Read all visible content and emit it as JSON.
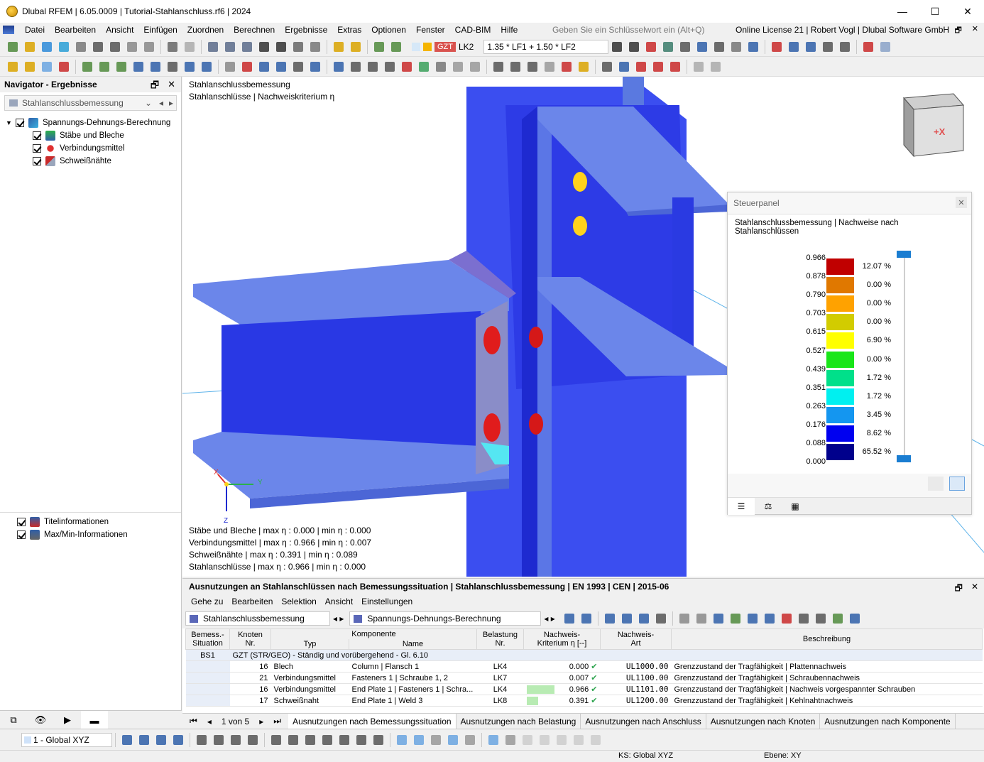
{
  "window": {
    "title": "Dlubal RFEM | 6.05.0009 | Tutorial-Stahlanschluss.rf6 | 2024",
    "controls": [
      "—",
      "☐",
      "✕"
    ]
  },
  "menubar": {
    "items": [
      "Datei",
      "Bearbeiten",
      "Ansicht",
      "Einfügen",
      "Zuordnen",
      "Berechnen",
      "Ergebnisse",
      "Extras",
      "Optionen",
      "Fenster",
      "CAD-BIM",
      "Hilfe"
    ],
    "search_placeholder": "Geben Sie ein Schlüsselwort ein (Alt+Q)",
    "license": "Online License 21 | Robert Vogl | Dlubal Software GmbH"
  },
  "loadcase": {
    "badge": "GZT",
    "case": "LK2",
    "combination": "1.35 * LF1 + 1.50 * LF2"
  },
  "navigator": {
    "title": "Navigator - Ergebnisse",
    "combo": "Stahlanschlussbemessung",
    "tree": [
      {
        "label": "Spannungs-Dehnungs-Berechnung",
        "icon": "stress-strain-icon"
      },
      {
        "label": "Stäbe und Bleche",
        "icon": "members-plates-icon"
      },
      {
        "label": "Verbindungsmittel",
        "icon": "fasteners-icon"
      },
      {
        "label": "Schweißnähte",
        "icon": "welds-icon"
      }
    ],
    "extra": [
      {
        "label": "Titelinformationen",
        "icon": "title-info-icon"
      },
      {
        "label": "Max/Min-Informationen",
        "icon": "maxmin-info-icon"
      }
    ]
  },
  "viewport": {
    "header_line1": "Stahlanschlussbemessung",
    "header_line2": "Stahlanschlüsse | Nachweiskriterium η",
    "axis_x": "X",
    "axis_y": "Y",
    "axis_z": "Z",
    "cube_label": "+X",
    "summary": [
      "Stäbe und Bleche | max η : 0.000 | min η : 0.000",
      "Verbindungsmittel | max η : 0.966 | min η : 0.007",
      "Schweißnähte | max η : 0.391 | min η : 0.089",
      "Stahlanschlüsse | max η : 0.966 | min η : 0.000"
    ]
  },
  "panel": {
    "title": "Steuerpanel",
    "subtitle": "Stahlanschlussbemessung | Nachweise nach Stahlanschlüssen",
    "values": [
      "0.966",
      "0.878",
      "0.790",
      "0.703",
      "0.615",
      "0.527",
      "0.439",
      "0.351",
      "0.263",
      "0.176",
      "0.088",
      "0.000"
    ],
    "colors": [
      "#c00000",
      "#e07800",
      "#ffa200",
      "#d2cc00",
      "#ffff00",
      "#19e619",
      "#00e08a",
      "#00f0f0",
      "#1496f0",
      "#0000f0",
      "#00008c"
    ],
    "percents": [
      "12.07 %",
      "0.00 %",
      "0.00 %",
      "0.00 %",
      "6.90 %",
      "0.00 %",
      "1.72 %",
      "1.72 %",
      "3.45 %",
      "8.62 %",
      "65.52 %"
    ]
  },
  "results": {
    "title": "Ausnutzungen an Stahlanschlüssen nach Bemessungssituation | Stahlanschlussbemessung | EN 1993 | CEN | 2015-06",
    "menu": [
      "Gehe zu",
      "Bearbeiten",
      "Selektion",
      "Ansicht",
      "Einstellungen"
    ],
    "combo1": "Stahlanschlussbemessung",
    "combo2": "Spannungs-Dehnungs-Berechnung",
    "headers": {
      "situation": "Bemess.-\nSituation",
      "node": "Knoten\nNr.",
      "component": "Komponente",
      "type": "Typ",
      "name": "Name",
      "loading": "Belastung\nNr.",
      "criterion": "Nachweis-\nKriterium η [--]",
      "check": "Nachweis-\nArt",
      "description": "Beschreibung"
    },
    "situation": "BS1",
    "group": "GZT (STR/GEO) - Ständig und vorübergehend - Gl. 6.10",
    "rows": [
      {
        "node": "16",
        "type": "Blech",
        "name": "Column | Flansch 1",
        "load": "LK4",
        "eta": "0.000",
        "eta_frac": 0.0,
        "check": "UL1000.00",
        "desc": "Grenzzustand der Tragfähigkeit | Plattennachweis"
      },
      {
        "node": "21",
        "type": "Verbindungsmittel",
        "name": "Fasteners 1 | Schraube 1, 2",
        "load": "LK7",
        "eta": "0.007",
        "eta_frac": 0.007,
        "check": "UL1100.00",
        "desc": "Grenzzustand der Tragfähigkeit | Schraubennachweis"
      },
      {
        "node": "16",
        "type": "Verbindungsmittel",
        "name": "End Plate 1 | Fasteners 1 | Schra...",
        "load": "LK4",
        "eta": "0.966",
        "eta_frac": 0.966,
        "check": "UL1101.00",
        "desc": "Grenzzustand der Tragfähigkeit | Nachweis vorgespannter Schrauben"
      },
      {
        "node": "17",
        "type": "Schweißnaht",
        "name": "End Plate 1 | Weld 3",
        "load": "LK8",
        "eta": "0.391",
        "eta_frac": 0.391,
        "check": "UL1200.00",
        "desc": "Grenzzustand der Tragfähigkeit | Kehlnahtnachweis"
      }
    ],
    "pager": "1 von 5",
    "tabs": [
      "Ausnutzungen nach Bemessungssituation",
      "Ausnutzungen nach Belastung",
      "Ausnutzungen nach Anschluss",
      "Ausnutzungen nach Knoten",
      "Ausnutzungen nach Komponente"
    ]
  },
  "status": {
    "cs_combo": "1 - Global XYZ",
    "ks": "KS: Global XYZ",
    "plane": "Ebene: XY"
  }
}
